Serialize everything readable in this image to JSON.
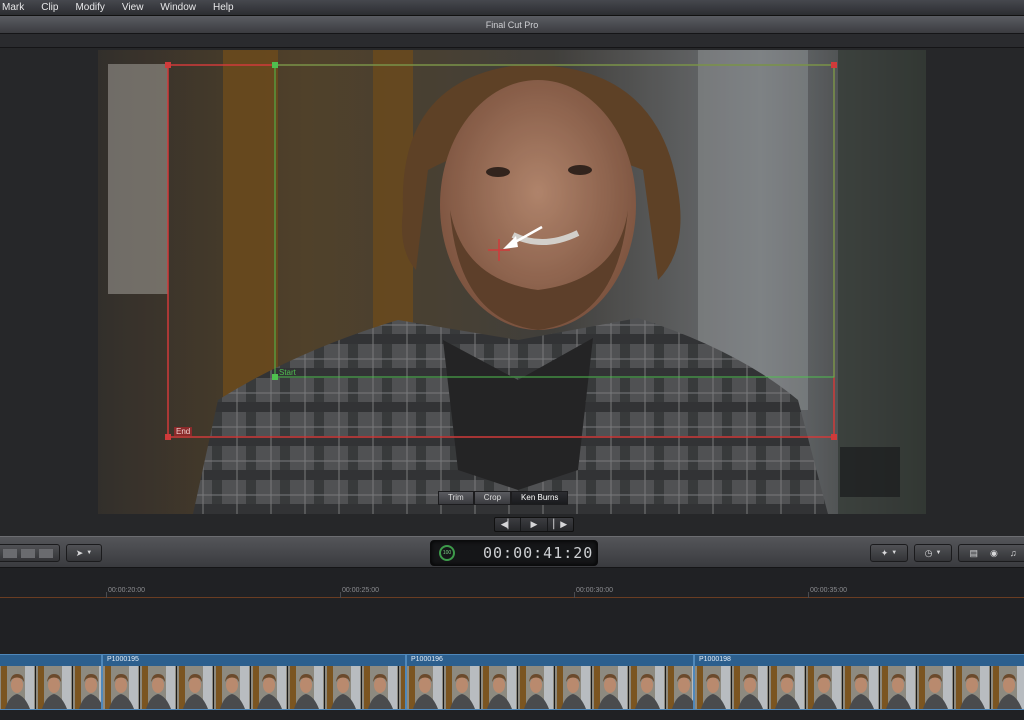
{
  "menubar": {
    "items": [
      {
        "label": "Mark"
      },
      {
        "label": "Clip"
      },
      {
        "label": "Modify"
      },
      {
        "label": "View"
      },
      {
        "label": "Window"
      },
      {
        "label": "Help"
      }
    ]
  },
  "window": {
    "title": "Final Cut Pro"
  },
  "viewer": {
    "overlay": {
      "start_label": "Start",
      "end_label": "End",
      "start_color": "#4fbf4f",
      "end_color": "#d03a3a"
    },
    "mode_buttons": [
      {
        "label": "Trim"
      },
      {
        "label": "Crop"
      },
      {
        "label": "Ken Burns"
      }
    ],
    "active_mode": "Ken Burns",
    "playback": {
      "prev_icon": "step-back-icon",
      "play_icon": "play-icon",
      "next_icon": "step-forward-icon"
    }
  },
  "toolbar": {
    "timecode": "00:00:41:20",
    "timecode_badge": "100"
  },
  "timeline": {
    "ruler_labels": [
      "00:00:20:00",
      "00:00:25:00",
      "00:00:30:00",
      "00:00:35:00"
    ],
    "clips": [
      {
        "name": ""
      },
      {
        "name": "P1000195"
      },
      {
        "name": "P1000196"
      },
      {
        "name": "P1000198"
      }
    ],
    "accent": "#2c5f8e"
  }
}
